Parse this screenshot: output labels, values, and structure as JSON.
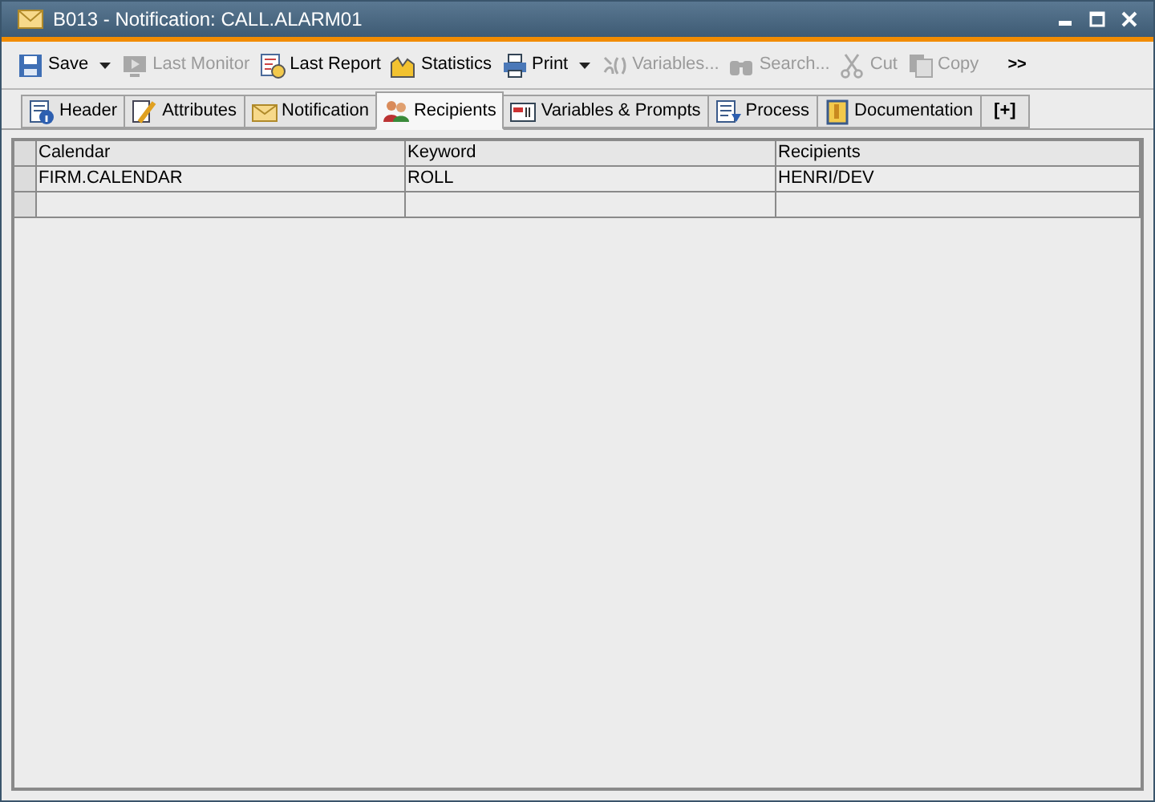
{
  "window": {
    "title": "B013 - Notification: CALL.ALARM01"
  },
  "toolbar": [
    {
      "label": "Save",
      "disabled": false,
      "dropdown": true
    },
    {
      "label": "Last Monitor",
      "disabled": true,
      "dropdown": false
    },
    {
      "label": "Last Report",
      "disabled": false,
      "dropdown": false
    },
    {
      "label": "Statistics",
      "disabled": false,
      "dropdown": false
    },
    {
      "label": "Print",
      "disabled": false,
      "dropdown": true
    },
    {
      "label": "Variables...",
      "disabled": true,
      "dropdown": false
    },
    {
      "label": "Search...",
      "disabled": true,
      "dropdown": false
    },
    {
      "label": "Cut",
      "disabled": true,
      "dropdown": false
    },
    {
      "label": "Copy",
      "disabled": true,
      "dropdown": false
    }
  ],
  "toolbar_overflow": ">>",
  "tabs": [
    {
      "label": "Header",
      "selected": false
    },
    {
      "label": "Attributes",
      "selected": false
    },
    {
      "label": "Notification",
      "selected": false
    },
    {
      "label": "Recipients",
      "selected": true
    },
    {
      "label": "Variables & Prompts",
      "selected": false
    },
    {
      "label": "Process",
      "selected": false
    },
    {
      "label": "Documentation",
      "selected": false
    }
  ],
  "add_tab": "[+]",
  "table": {
    "columns": [
      "Calendar",
      "Keyword",
      "Recipients"
    ],
    "rows": [
      [
        "FIRM.CALENDAR",
        "ROLL",
        "HENRI/DEV"
      ]
    ]
  }
}
